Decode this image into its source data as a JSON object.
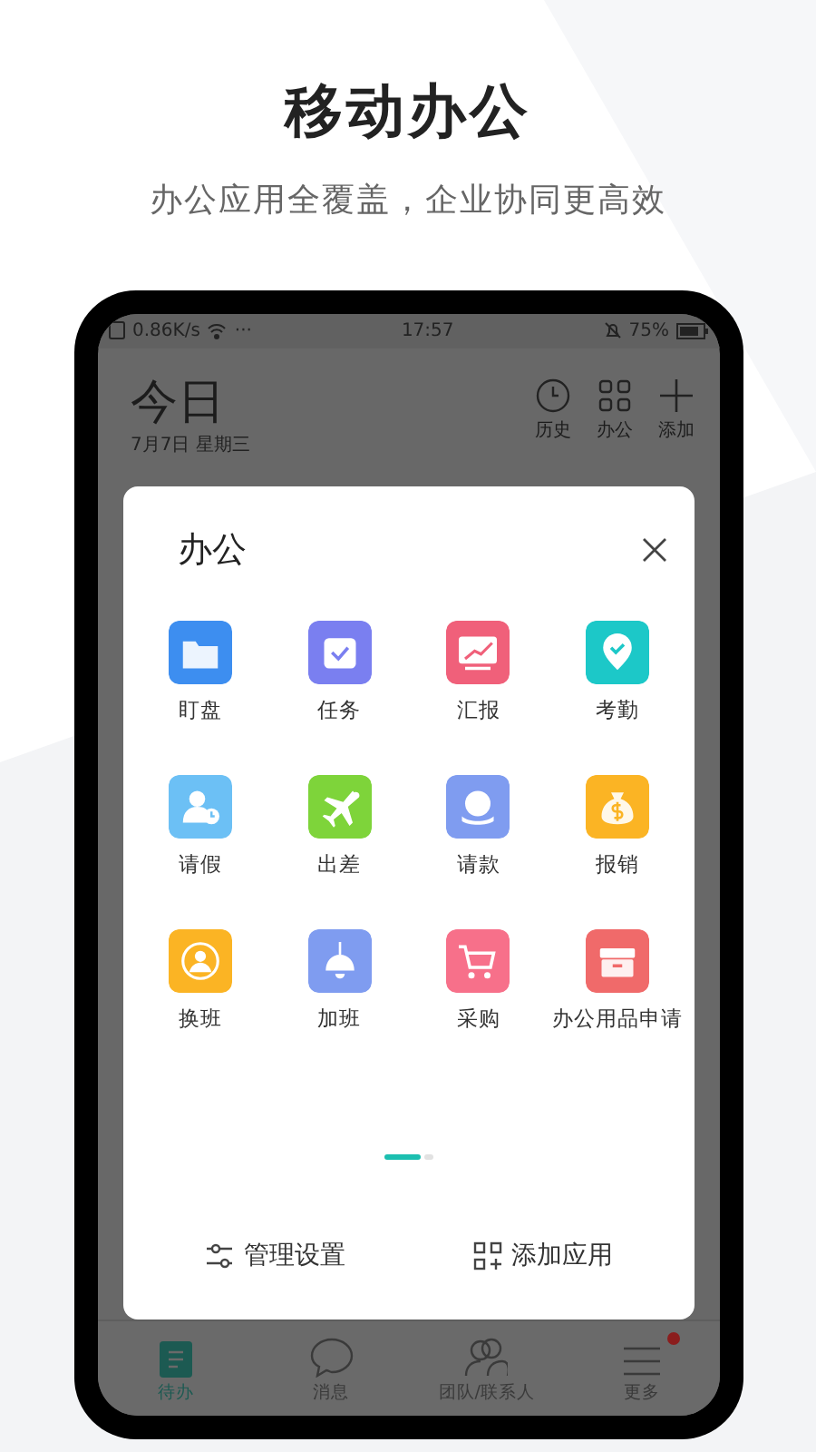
{
  "headline": "移动办公",
  "tagline": "办公应用全覆盖，企业协同更高效",
  "status_bar": {
    "speed": "0.86K/s",
    "dots": "···",
    "time": "17:57",
    "battery": "75%"
  },
  "header": {
    "title": "今日",
    "date": "7月7日 星期三",
    "actions": [
      {
        "kind": "clock",
        "label": "历史"
      },
      {
        "kind": "grid",
        "label": "办公"
      },
      {
        "kind": "plus",
        "label": "添加"
      }
    ]
  },
  "dialog": {
    "title": "办公",
    "apps": [
      {
        "label": "盯盘",
        "kind": "folder",
        "color": "#3d8ef0"
      },
      {
        "label": "任务",
        "kind": "task",
        "color": "#7a7ff0"
      },
      {
        "label": "汇报",
        "kind": "chart",
        "color": "#f0607a"
      },
      {
        "label": "考勤",
        "kind": "pin",
        "color": "#1cc8c8"
      },
      {
        "label": "请假",
        "kind": "leave",
        "color": "#6cc0f5"
      },
      {
        "label": "出差",
        "kind": "plane",
        "color": "#7ed43a"
      },
      {
        "label": "请款",
        "kind": "coin",
        "color": "#7f9cf0"
      },
      {
        "label": "报销",
        "kind": "bag",
        "color": "#fbb424"
      },
      {
        "label": "换班",
        "kind": "swap",
        "color": "#fbb424"
      },
      {
        "label": "加班",
        "kind": "lamp",
        "color": "#7f9cf0"
      },
      {
        "label": "采购",
        "kind": "cart",
        "color": "#f7708a"
      },
      {
        "label": "办公用品申请",
        "kind": "box",
        "color": "#f06a6a"
      }
    ],
    "pages": [
      {
        "selected": true
      },
      {
        "selected": false
      }
    ],
    "footer": [
      {
        "kind": "settings",
        "label": "管理设置"
      },
      {
        "kind": "add-app",
        "label": "添加应用"
      }
    ]
  },
  "tabs": [
    {
      "kind": "todo",
      "label": "待办",
      "selected": true,
      "badge": false
    },
    {
      "kind": "chat",
      "label": "消息",
      "selected": false,
      "badge": false
    },
    {
      "kind": "people",
      "label": "团队/联系人",
      "selected": false,
      "badge": false
    },
    {
      "kind": "menu",
      "label": "更多",
      "selected": false,
      "badge": true
    }
  ]
}
